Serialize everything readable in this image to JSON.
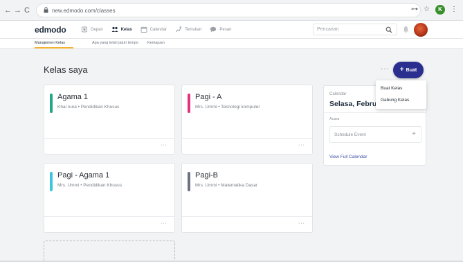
{
  "browser": {
    "url": "new.edmodo.com/classes",
    "back_glyph": "←",
    "forward_glyph": "→",
    "reload_glyph": "C",
    "key_glyph": "⊶",
    "star_glyph": "☆",
    "menu_glyph": "⋮",
    "profile_initial": "K"
  },
  "header": {
    "logo": "edmodo",
    "nav": [
      {
        "label": "Depan",
        "icon": "home-icon"
      },
      {
        "label": "Kelas",
        "icon": "classes-icon",
        "active": true
      },
      {
        "label": "Calendar",
        "icon": "calendar-icon"
      },
      {
        "label": "Temukan",
        "icon": "discover-icon"
      },
      {
        "label": "Pesan",
        "icon": "messages-icon"
      }
    ],
    "search_placeholder": "Pencarian"
  },
  "subnav": {
    "tabs": [
      "Manajemen Kelas",
      "Apa yang telah jatuh tempo",
      "Kemajuan"
    ]
  },
  "main": {
    "title": "Kelas saya",
    "more": "···",
    "create": {
      "plus": "+",
      "label": "Buat"
    },
    "cards": [
      {
        "name": "Agama 1",
        "meta": "Khai runa • Pendidikan Khusus",
        "accent": "#26a48a",
        "menu": "···"
      },
      {
        "name": "Pagi - A",
        "meta": "Mrs. Ummi • Teknologi komputer",
        "accent": "#e4317c",
        "menu": "···"
      },
      {
        "name": "Pagi - Agama 1",
        "meta": "Mrs. Ummi • Pendidikan Khusus",
        "accent": "#3cc6de",
        "menu": "···"
      },
      {
        "name": "Pagi-B",
        "meta": "Mrs. Ummi • Matematika Dasar",
        "accent": "#6b7280",
        "menu": "···"
      }
    ]
  },
  "dropdown": {
    "items": [
      "Buat Kelas",
      "Gabung Kelas"
    ]
  },
  "calendar": {
    "label": "Calendar",
    "date": "Selasa, Februa",
    "events_label": "Acara",
    "schedule_event": "Schedule Event",
    "add": "+",
    "view_full": "View Full Calendar"
  },
  "colors": {
    "create_button": "#2a2f8f",
    "subnav_underline": "#f2b233",
    "link": "#3b4aa8"
  }
}
